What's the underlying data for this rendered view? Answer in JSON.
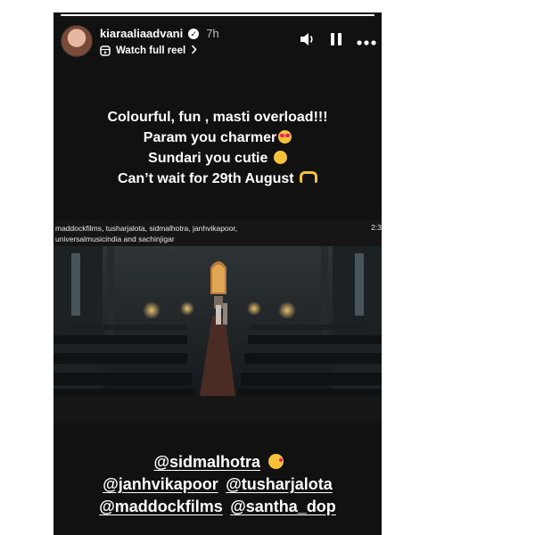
{
  "story": {
    "progress_fraction": 1.0,
    "user": {
      "username": "kiaraaliaadvani",
      "verified_icon": "verified-badge-icon",
      "time_ago": "7h"
    },
    "watch_full_reel_label": "Watch full reel",
    "controls": [
      "volume-icon",
      "pause-icon",
      "more-icon"
    ],
    "caption": [
      "Colourful, fun , masti overload!!!",
      "Param you charmer",
      "Sundari you cutie",
      "Can’t wait for 29th August"
    ],
    "shared_post": {
      "credits_line1": "maddockfilms, tusharjalota, sidmalhotra, janhvikapoor,",
      "credits_line2": "universalmusicindia and sachinjigar",
      "duration": "2:3"
    },
    "mentions": {
      "row1": [
        "@sidmalhotra"
      ],
      "row2": [
        "@janhvikapoor",
        "@tusharjalota"
      ],
      "row3": [
        "@maddockfilms",
        "@santha_dop"
      ]
    },
    "colors": {
      "background": "#111111",
      "text": "#ffffff",
      "emoji_yellow": "#f5c23a",
      "heart_red": "#e0245e"
    }
  }
}
